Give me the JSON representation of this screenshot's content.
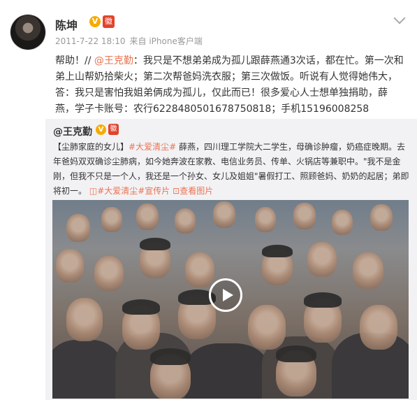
{
  "post": {
    "author": "陈坤",
    "verified_mark": "V",
    "time": "2011-7-22 18:10",
    "source": "来自 iPhone客户端",
    "text_prefix": "帮助！//",
    "mention": "@王克勤",
    "text_body": "：我只是不想弟弟成为孤儿跟薛燕通3次话，都在忙。第一次和弟上山帮奶拾柴火；第二次帮爸妈洗衣服；第三次做饭。听说有人觉得她伟大，答：我只是害怕我姐弟俩成为孤儿，仅此而已！很多爱心人士想单独捐助，薛燕，学子卡账号：农行6228480501678750818；手机15196008258"
  },
  "repost": {
    "author": "@王克勤",
    "verified_mark": "V",
    "lead": "【尘肺家庭的女儿】",
    "tag1": "#大爱清尘#",
    "text1": "薛燕，四川理工学院大二学生，母确诊肿瘤，奶癌症晚期。去年爸妈双双确诊尘肺病，如今她奔波在家教、电信业务员、传单、火锅店等兼职中。\"我不是金刚，但我不只是一个人，我还是一个孙女、女儿及姐姐\"暑假打工、照顾爸妈、奶奶的起居；弟即将初一。",
    "tag2": "#大爱清尘#宣传片",
    "view_image": "查看图片"
  },
  "colors": {
    "accent": "#eb7350",
    "verified": "#f6ab00",
    "repost_bg": "#f2f2f5"
  }
}
